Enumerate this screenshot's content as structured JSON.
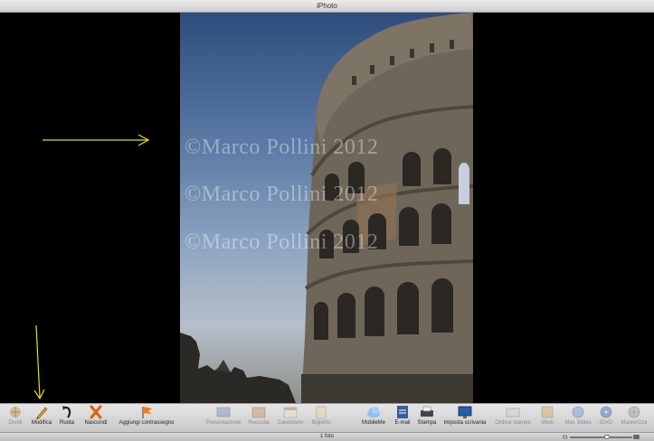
{
  "window": {
    "title": "iPhoto"
  },
  "photo": {
    "watermark_lines": [
      "©Marco Pollini 2012",
      "©Marco Pollini 2012",
      "©Marco Pollini 2012"
    ]
  },
  "toolbar": {
    "left_tools": [
      {
        "label": "Dividi",
        "icon": "split-icon",
        "enabled": false
      },
      {
        "label": "Modifica",
        "icon": "pencil-icon",
        "enabled": true
      },
      {
        "label": "Ruota",
        "icon": "rotate-icon",
        "enabled": true
      },
      {
        "label": "Nascondi",
        "icon": "hide-x-icon",
        "enabled": true
      },
      {
        "label": "Aggiungi contrassegno",
        "icon": "flag-icon",
        "enabled": true
      }
    ],
    "create_tools": [
      {
        "label": "Presentazione",
        "icon": "slideshow-icon",
        "enabled": false
      },
      {
        "label": "Raccolta",
        "icon": "book-icon",
        "enabled": false
      },
      {
        "label": "Calendario",
        "icon": "calendar-icon",
        "enabled": false
      },
      {
        "label": "Biglietto",
        "icon": "card-icon",
        "enabled": false
      }
    ],
    "share_tools": [
      {
        "label": "MobileMe",
        "icon": "cloud-icon",
        "enabled": true
      },
      {
        "label": "E-mail",
        "icon": "email-icon",
        "enabled": true
      },
      {
        "label": "Stampa",
        "icon": "printer-icon",
        "enabled": true
      },
      {
        "label": "Imposta scrivania",
        "icon": "desktop-icon",
        "enabled": true
      },
      {
        "label": "Ordina stampe",
        "icon": "order-prints-icon",
        "enabled": false
      },
      {
        "label": "iWeb",
        "icon": "iweb-icon",
        "enabled": false
      },
      {
        "label": "Mac Slides",
        "icon": "mac-slides-icon",
        "enabled": false
      },
      {
        "label": "iDVD",
        "icon": "idvd-icon",
        "enabled": false
      },
      {
        "label": "Masterizza",
        "icon": "burn-disc-icon",
        "enabled": false
      }
    ]
  },
  "status": {
    "count_text": "1 foto",
    "zoom_level": 0.6
  },
  "colors": {
    "annotation_arrow": "#e8e000"
  }
}
